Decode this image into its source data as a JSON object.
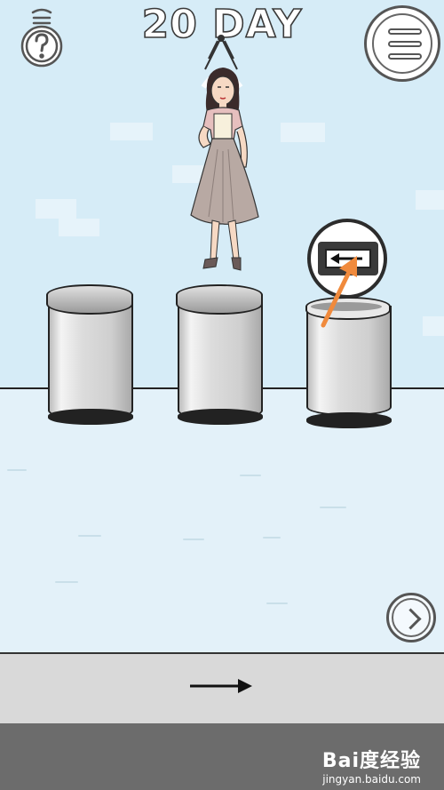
{
  "header": {
    "title": "20 DAY"
  },
  "icons": {
    "hint": "lightbulb-question-icon",
    "menu": "hamburger-menu-icon",
    "next": "chevron-right-icon",
    "solution_arrow": "arrow-right-icon",
    "sign_arrow": "arrow-left-icon"
  },
  "scene": {
    "character": "hanging-woman",
    "bins": 3,
    "highlighted_bin": 3
  },
  "watermark": {
    "brand": "Bai度经验",
    "url": "jingyan.baidu.com"
  },
  "colors": {
    "accent_arrow": "#f08a3c",
    "sky": "#d6ecf7",
    "floor": "#e3f1f9",
    "strip": "#d9d9d9",
    "bottom": "#6c6c6c"
  }
}
